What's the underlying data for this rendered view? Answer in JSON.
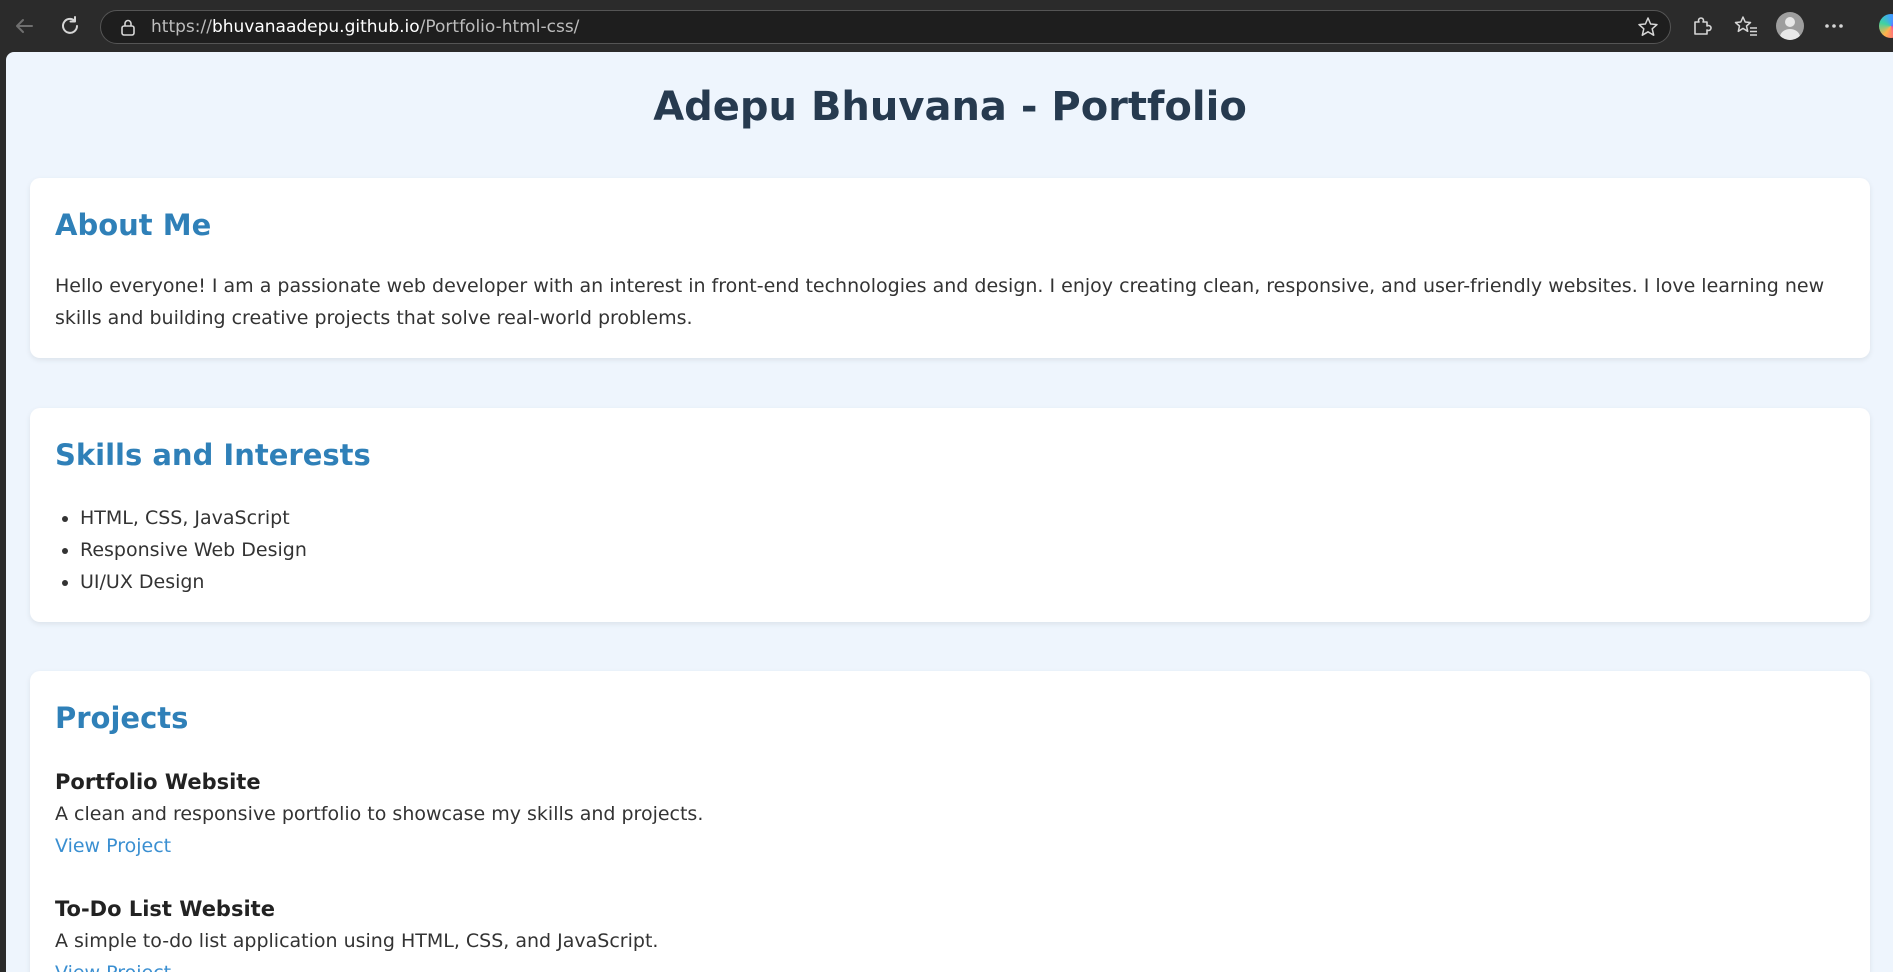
{
  "browser": {
    "url_prefix": "https://",
    "url_host": "bhuvanaadepu.github.io",
    "url_path": "/Portfolio-html-css/"
  },
  "page": {
    "title": "Adepu Bhuvana - Portfolio",
    "about": {
      "heading": "About Me",
      "text": "Hello everyone! I am a passionate web developer with an interest in front-end technologies and design. I enjoy creating clean, responsive, and user-friendly websites. I love learning new skills and building creative projects that solve real-world problems."
    },
    "skills": {
      "heading": "Skills and Interests",
      "items": [
        "HTML, CSS, JavaScript",
        "Responsive Web Design",
        "UI/UX Design"
      ]
    },
    "projects": {
      "heading": "Projects",
      "items": [
        {
          "name": "Portfolio Website",
          "description": "A clean and responsive portfolio to showcase my skills and projects.",
          "link_label": "View Project"
        },
        {
          "name": "To-Do List Website",
          "description": "A simple to-do list application using HTML, CSS, and JavaScript.",
          "link_label": "View Project"
        }
      ]
    }
  },
  "colors": {
    "page_background": "#eef5fd",
    "title": "#263a4f",
    "section_heading": "#2f80b8",
    "link": "#3a8fd1",
    "chrome_background": "#2b2b2b"
  }
}
